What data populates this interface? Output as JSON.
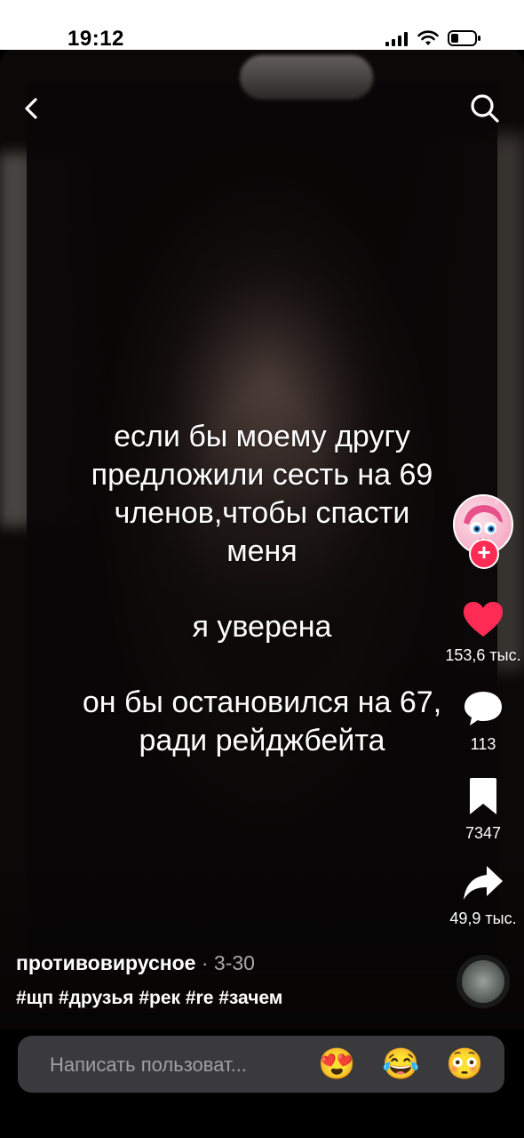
{
  "status_bar": {
    "time": "19:12"
  },
  "video": {
    "caption_lines": [
      "если бы моему другу",
      "предложили сесть на 69",
      "членов,чтобы спасти",
      "меня",
      "я уверена",
      "он бы остановился на 67,",
      "ради рейджбейта"
    ]
  },
  "actions": {
    "likes": "153,6 тыс.",
    "comments": "113",
    "saves": "7347",
    "shares": "49,9 тыс."
  },
  "post": {
    "author": "противовирусное",
    "date": "· 3-30",
    "hashtags": "#щп #друзья #рек #re #зачем"
  },
  "comment": {
    "placeholder": "Написать пользоват...",
    "emojis": [
      "😍",
      "😂",
      "😳"
    ]
  },
  "colors": {
    "like": "#fe2c55",
    "follow": "#fe2c55",
    "comment_bar": "#3a3a3c"
  }
}
